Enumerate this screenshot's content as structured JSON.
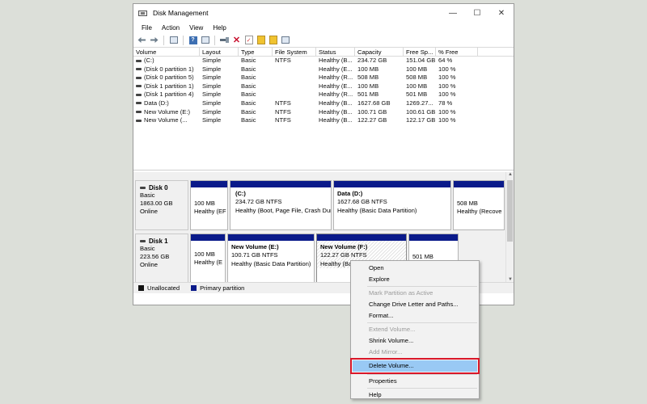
{
  "window": {
    "title": "Disk Management",
    "controls": [
      "—",
      "☐",
      "✕"
    ]
  },
  "menu": [
    "File",
    "Action",
    "View",
    "Help"
  ],
  "columns": [
    "Volume",
    "Layout",
    "Type",
    "File System",
    "Status",
    "Capacity",
    "Free Sp...",
    "% Free"
  ],
  "volumes": [
    {
      "volume": "(C:)",
      "layout": "Simple",
      "type": "Basic",
      "fs": "NTFS",
      "status": "Healthy (B...",
      "capacity": "234.72 GB",
      "free": "151.04 GB",
      "pct": "64 %"
    },
    {
      "volume": "(Disk 0 partition 1)",
      "layout": "Simple",
      "type": "Basic",
      "fs": "",
      "status": "Healthy (E...",
      "capacity": "100 MB",
      "free": "100 MB",
      "pct": "100 %"
    },
    {
      "volume": "(Disk 0 partition 5)",
      "layout": "Simple",
      "type": "Basic",
      "fs": "",
      "status": "Healthy (R...",
      "capacity": "508 MB",
      "free": "508 MB",
      "pct": "100 %"
    },
    {
      "volume": "(Disk 1 partition 1)",
      "layout": "Simple",
      "type": "Basic",
      "fs": "",
      "status": "Healthy (E...",
      "capacity": "100 MB",
      "free": "100 MB",
      "pct": "100 %"
    },
    {
      "volume": "(Disk 1 partition 4)",
      "layout": "Simple",
      "type": "Basic",
      "fs": "",
      "status": "Healthy (R...",
      "capacity": "501 MB",
      "free": "501 MB",
      "pct": "100 %"
    },
    {
      "volume": "Data (D:)",
      "layout": "Simple",
      "type": "Basic",
      "fs": "NTFS",
      "status": "Healthy (B...",
      "capacity": "1627.68 GB",
      "free": "1269.27...",
      "pct": "78 %"
    },
    {
      "volume": "New Volume (E:)",
      "layout": "Simple",
      "type": "Basic",
      "fs": "NTFS",
      "status": "Healthy (B...",
      "capacity": "100.71 GB",
      "free": "100.61 GB",
      "pct": "100 %"
    },
    {
      "volume": "New Volume (...",
      "layout": "Simple",
      "type": "Basic",
      "fs": "NTFS",
      "status": "Healthy (B...",
      "capacity": "122.27 GB",
      "free": "122.17 GB",
      "pct": "100 %"
    }
  ],
  "disks": [
    {
      "name": "Disk 0",
      "kind": "Basic",
      "size": "1863.00 GB",
      "state": "Online",
      "partitions": [
        {
          "name": "",
          "line1": "100 MB",
          "line2": "Healthy (EF"
        },
        {
          "name": "(C:)",
          "line1": "234.72 GB NTFS",
          "line2": "Healthy (Boot, Page File, Crash Dun"
        },
        {
          "name": "Data  (D:)",
          "line1": "1627.68 GB NTFS",
          "line2": "Healthy (Basic Data Partition)"
        },
        {
          "name": "",
          "line1": "508 MB",
          "line2": "Healthy (Recove"
        }
      ]
    },
    {
      "name": "Disk 1",
      "kind": "Basic",
      "size": "223.56 GB",
      "state": "Online",
      "partitions": [
        {
          "name": "",
          "line1": "100 MB",
          "line2": "Healthy (E"
        },
        {
          "name": "New Volume  (E:)",
          "line1": "100.71 GB NTFS",
          "line2": "Healthy (Basic Data Partition)"
        },
        {
          "name": "New Volume  (F:)",
          "line1": "122.27 GB NTFS",
          "line2": "Healthy (Ba"
        },
        {
          "name": "",
          "line1": "501 MB",
          "line2": ""
        }
      ]
    }
  ],
  "legend": [
    {
      "label": "Unallocated",
      "color": "#111111"
    },
    {
      "label": "Primary partition",
      "color": "#0a1a8a"
    }
  ],
  "context_menu": {
    "open": "Open",
    "explore": "Explore",
    "mark_active": "Mark Partition as Active",
    "change_letter": "Change Drive Letter and Paths...",
    "format": "Format...",
    "extend": "Extend Volume...",
    "shrink": "Shrink Volume...",
    "add_mirror": "Add Mirror...",
    "delete": "Delete Volume...",
    "properties": "Properties",
    "help": "Help"
  }
}
